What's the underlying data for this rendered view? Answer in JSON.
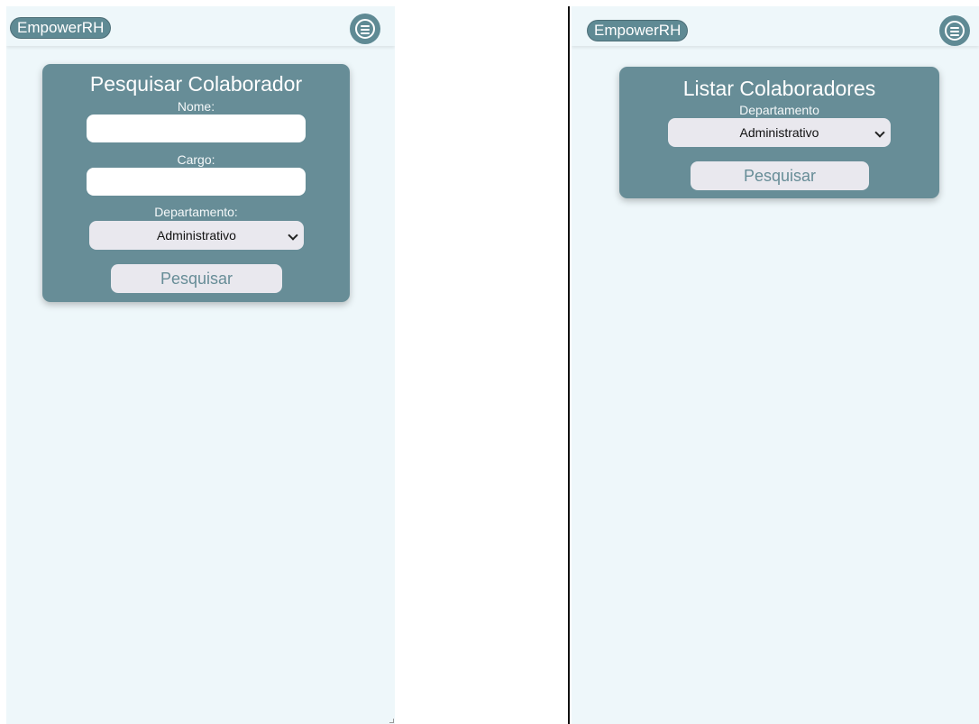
{
  "left_screen": {
    "app_name": "EmpowerRH",
    "card": {
      "title": "Pesquisar Colaborador",
      "nome_label": "Nome:",
      "nome_value": "",
      "cargo_label": "Cargo:",
      "cargo_value": "",
      "departamento_label": "Departamento:",
      "departamento_selected": "Administrativo",
      "submit_label": "Pesquisar"
    }
  },
  "right_screen": {
    "app_name": "EmpowerRH",
    "card": {
      "title": "Listar Colaboradores",
      "departamento_label": "Departamento",
      "departamento_selected": "Administrativo",
      "submit_label": "Pesquisar"
    }
  },
  "icons": {
    "menu": "hamburger-circle-icon",
    "select_arrow": "chevron-down-icon"
  },
  "colors": {
    "page_background": "#eef7fa",
    "card_background": "#678d97",
    "accent": "#5f8a94",
    "button_background": "#e9e8ee",
    "button_text": "#678d97"
  }
}
